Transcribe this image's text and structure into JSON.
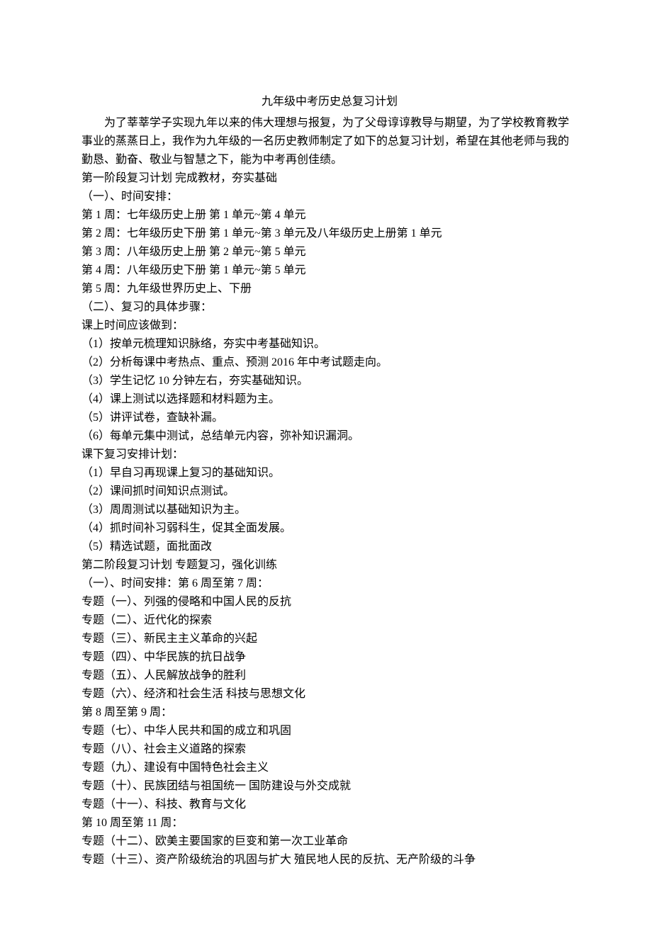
{
  "title": "九年级中考历史总复习计划",
  "intro": "为了莘莘学子实现九年以来的伟大理想与报复，为了父母谆谆教导与期望，为了学校教育教学事业的蒸蒸日上，我作为九年级的一名历史教师制定了如下的总复习计划，希望在其他老师与我的勤恳、勤奋、敬业与智慧之下，能为中考再创佳绩。",
  "lines": [
    "第一阶段复习计划  完成教材，夯实基础",
    "（一）、时间安排：",
    "第 1 周：七年级历史上册  第 1 单元~第 4 单元",
    "第 2 周：七年级历史下册  第 1 单元~第 3 单元及八年级历史上册第 1 单元",
    "第 3 周：八年级历史上册  第 2 单元~第 5 单元",
    "第 4 周：八年级历史下册  第 1 单元~第 5 单元",
    "第 5 周：九年级世界历史上、下册",
    "（二）、复习的具体步骤：",
    "课上时间应该做到：",
    "（1）按单元梳理知识脉络，夯实中考基础知识。",
    "（2）分析每课中考热点、重点、预测 2016 年中考试题走向。",
    "（3）学生记忆 10 分钟左右，夯实基础知识。",
    "（4）课上测试以选择题和材料题为主。",
    "（5）讲评试卷，查缺补漏。",
    "（6）每单元集中测试，总结单元内容，弥补知识漏洞。",
    "课下复习安排计划：",
    "（1）早自习再现课上复习的基础知识。",
    "（2）课间抓时间知识点测试。",
    "（3）周周测试以基础知识为主。",
    "（4）抓时间补习弱科生，促其全面发展。",
    "（5）精选试题，面批面改",
    "第二阶段复习计划  专题复习，强化训练",
    "（一）、时间安排：第 6 周至第 7 周：",
    "专题（一）、列强的侵略和中国人民的反抗",
    "专题（二）、近代化的探索",
    "专题（三）、新民主主义革命的兴起",
    "专题（四）、中华民族的抗日战争",
    "专题（五）、人民解放战争的胜利",
    "专题（六）、经济和社会生活  科技与思想文化",
    "第 8 周至第 9 周：",
    "专题（七）、中华人民共和国的成立和巩固",
    "专题（八）、社会主义道路的探索",
    "专题（九）、建设有中国特色社会主义",
    "专题（十）、民族团结与祖国统一  国防建设与外交成就",
    "专题（十一）、科技、教育与文化",
    "第 10 周至第 11 周：",
    "专题（十二）、欧美主要国家的巨变和第一次工业革命",
    "专题（十三）、资产阶级统治的巩固与扩大  殖民地人民的反抗、无产阶级的斗争"
  ]
}
